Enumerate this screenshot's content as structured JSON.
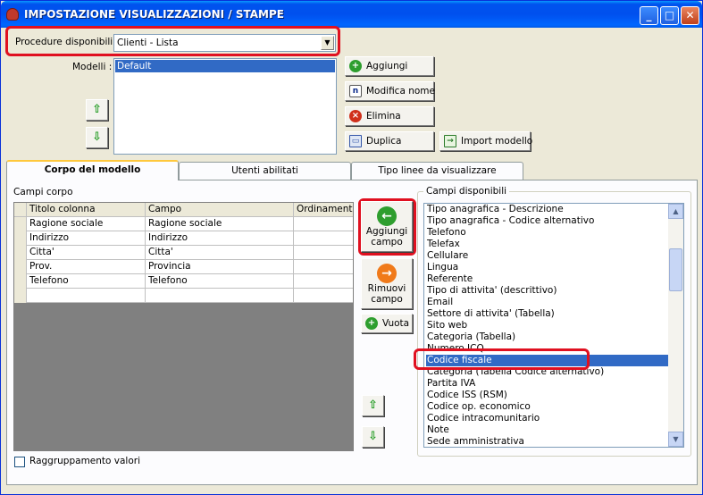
{
  "window": {
    "title": "IMPOSTAZIONE VISUALIZZAZIONI / STAMPE",
    "minimize": "_",
    "maximize": "□",
    "close": "✕"
  },
  "procedure": {
    "label": "Procedure disponibili :",
    "value": "Clienti - Lista"
  },
  "modelli": {
    "label": "Modelli :",
    "items": [
      "Default"
    ]
  },
  "buttons": {
    "aggiungi": "Aggiungi",
    "modifica_nome": "Modifica nome",
    "elimina": "Elimina",
    "duplica": "Duplica",
    "import_modello": "Import modello"
  },
  "tabs": [
    {
      "label": "Corpo del modello"
    },
    {
      "label": "Utenti abilitati"
    },
    {
      "label": "Tipo linee da visualizzare"
    }
  ],
  "campi_corpo": {
    "label": "Campi corpo",
    "columns": [
      "Titolo colonna",
      "Campo",
      "Ordinamento"
    ],
    "rows": [
      [
        "Ragione sociale",
        "Ragione sociale",
        ""
      ],
      [
        "Indirizzo",
        "Indirizzo",
        ""
      ],
      [
        "Citta'",
        "Citta'",
        ""
      ],
      [
        "Prov.",
        "Provincia",
        ""
      ],
      [
        "Telefono",
        "Telefono",
        ""
      ],
      [
        "",
        "",
        ""
      ]
    ]
  },
  "middle_buttons": {
    "aggiungi_campo_1": "Aggiungi",
    "aggiungi_campo_2": "campo",
    "rimuovi_campo_1": "Rimuovi",
    "rimuovi_campo_2": "campo",
    "vuota": "Vuota"
  },
  "campi_disponibili": {
    "label": "Campi disponibili",
    "items": [
      "Tipo anagrafica - Descrizione",
      "Tipo anagrafica - Codice alternativo",
      "Telefono",
      "Telefax",
      "Cellulare",
      "Lingua",
      "Referente",
      "Tipo di attivita' (descrittivo)",
      "Email",
      "Settore di attivita' (Tabella)",
      "Sito web",
      "Categoria (Tabella)",
      "Numero ICQ",
      "Codice fiscale",
      "Categoria (Tabella Codice alternativo)",
      "Partita IVA",
      "Codice ISS (RSM)",
      "Codice op. economico",
      "Codice intracomunitario",
      "Note",
      "Sede amministrativa"
    ],
    "selected_index": 13
  },
  "raggruppamento": {
    "label": "Raggruppamento valori"
  },
  "colors": {
    "selection": "#316ac5",
    "highlight": "#e01020"
  },
  "icons": {
    "up": "arrow-up-icon",
    "down": "arrow-down-icon"
  }
}
